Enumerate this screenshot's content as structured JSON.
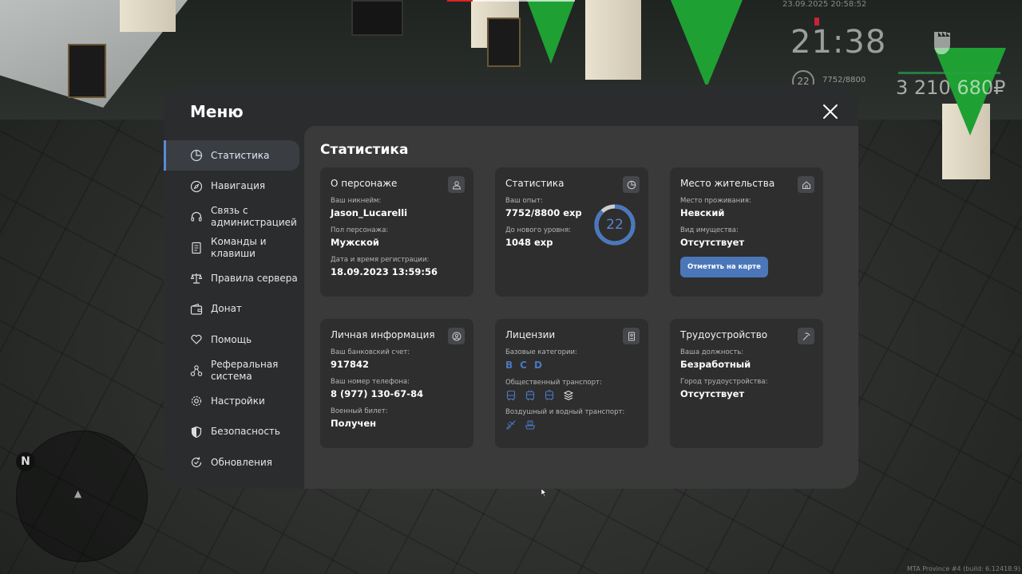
{
  "hud": {
    "datetime": "23.09.2025 20:58:52",
    "clock": "21:38",
    "level": "22",
    "exp": "7752/8800",
    "money": "3 210 680₽",
    "build": "MTA Province #4 (build: 6.12418.9)",
    "compass": "N"
  },
  "menu": {
    "title": "Меню",
    "sidebar": [
      {
        "label": "Статистика",
        "icon": "pie-chart-icon",
        "active": true
      },
      {
        "label": "Навигация",
        "icon": "compass-icon"
      },
      {
        "label": "Связь с администрацией",
        "icon": "headset-icon"
      },
      {
        "label": "Команды и клавиши",
        "icon": "document-icon"
      },
      {
        "label": "Правила сервера",
        "icon": "scales-icon"
      },
      {
        "label": "Донат",
        "icon": "wallet-icon"
      },
      {
        "label": "Помощь",
        "icon": "heart-hand-icon"
      },
      {
        "label": "Реферальная система",
        "icon": "network-icon"
      },
      {
        "label": "Настройки",
        "icon": "gear-icon"
      },
      {
        "label": "Безопасность",
        "icon": "shield-icon"
      },
      {
        "label": "Обновления",
        "icon": "refresh-icon"
      }
    ]
  },
  "content": {
    "title": "Статистика",
    "character": {
      "title": "О персонаже",
      "nickname_label": "Ваш никнейм:",
      "nickname": "Jason_Lucarelli",
      "gender_label": "Пол персонажа:",
      "gender": "Мужской",
      "reg_label": "Дата и время регистрации:",
      "reg": "18.09.2023 13:59:56"
    },
    "stats": {
      "title": "Статистика",
      "exp_label": "Ваш опыт:",
      "exp": "7752/8800 exp",
      "next_label": "До нового уровня:",
      "next": "1048 exp",
      "level": "22",
      "level_progress": 0.88
    },
    "residence": {
      "title": "Место жительства",
      "place_label": "Место проживания:",
      "place": "Невский",
      "property_label": "Вид имущества:",
      "property": "Отсутствует",
      "map_button": "Отметить на карте"
    },
    "personal": {
      "title": "Личная информация",
      "bank_label": "Ваш банковский счет:",
      "bank": "917842",
      "phone_label": "Ваш номер телефона:",
      "phone": "8 (977) 130-67-84",
      "military_label": "Военный билет:",
      "military": "Получен"
    },
    "licenses": {
      "title": "Лицензии",
      "base_label": "Базовые категории:",
      "categories": [
        "B",
        "C",
        "D"
      ],
      "public_label": "Общественный транспорт:",
      "public_icons": [
        "bus-icon",
        "trolleybus-icon",
        "tram-icon",
        "metro-icon"
      ],
      "air_label": "Воздушный и водный транспорт:",
      "air_icons": [
        "plane-icon",
        "boat-icon"
      ]
    },
    "employment": {
      "title": "Трудоустройство",
      "position_label": "Ваша должность:",
      "position": "Безработный",
      "city_label": "Город трудоустройства:",
      "city": "Отсутствует"
    }
  },
  "colors": {
    "accent": "#5b8ad6",
    "button": "#4b77b9",
    "panel": "#2b2c2d",
    "content": "#3a3a3b",
    "card": "#2e2e2f",
    "hud_green": "#1fa033"
  }
}
